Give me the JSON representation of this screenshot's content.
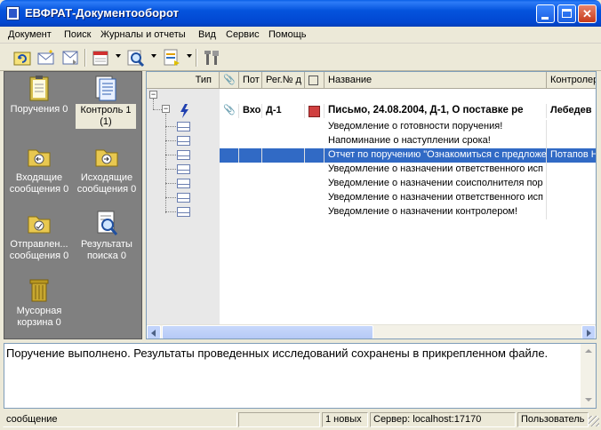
{
  "window": {
    "title": "ЕВФРАТ-Документооборот"
  },
  "menu": [
    "Документ",
    "Поиск",
    "Журналы и отчеты",
    "Вид",
    "Сервис",
    "Помощь"
  ],
  "toolbar": {
    "buttons": [
      "refresh-icon",
      "new-message-icon",
      "send-receive-icon",
      "calendar-icon",
      "search-icon",
      "report-icon",
      "settings-icon"
    ]
  },
  "sidebar": {
    "items": [
      {
        "label": "Поручения 0",
        "icon": "orders-icon"
      },
      {
        "label": "Контроль 1\n(1)",
        "label1": "Контроль 1",
        "label2": "(1)",
        "icon": "control-icon",
        "selected": true
      },
      {
        "label1": "Входящие",
        "label2": "сообщения 0",
        "icon": "incoming-folder-icon"
      },
      {
        "label1": "Исходящие",
        "label2": "сообщения 0",
        "icon": "outgoing-folder-icon"
      },
      {
        "label1": "Отправлен...",
        "label2": "сообщения 0",
        "icon": "sent-folder-icon"
      },
      {
        "label1": "Результаты",
        "label2": "поиска 0",
        "icon": "search-results-icon"
      },
      {
        "label1": "Мусорная",
        "label2": "корзина 0",
        "icon": "trash-icon"
      }
    ]
  },
  "list": {
    "columns": [
      "Тип",
      "",
      "Пот",
      "Рег.№ д",
      "",
      "Название",
      "Контролер"
    ],
    "rows": [
      {
        "type": "Вхо",
        "reg": "Д-1",
        "name": "Письмо, 24.08.2004, Д-1, О поставке ре",
        "controller": "Лебедев",
        "bold": true
      },
      {
        "name": "Уведомление о готовности поручения!"
      },
      {
        "name": "Напоминание о наступлении срока!"
      },
      {
        "name": "Отчет по поручению \"Ознакомиться с предложе",
        "controller": "Потапов Н",
        "selected": true
      },
      {
        "name": "Уведомление о назначении ответственного исп"
      },
      {
        "name": "Уведомление о назначении соисполнителя пор"
      },
      {
        "name": "Уведомление о назначении ответственного исп"
      },
      {
        "name": "Уведомление о назначении контролером!"
      }
    ]
  },
  "message_text": "Поручение выполнено. Результаты проведенных исследований сохранены в прикрепленном файле.",
  "status": {
    "left": "сообщение",
    "new": "1 новых",
    "server": "Сервер: localhost:17170",
    "user": "Пользователь"
  }
}
